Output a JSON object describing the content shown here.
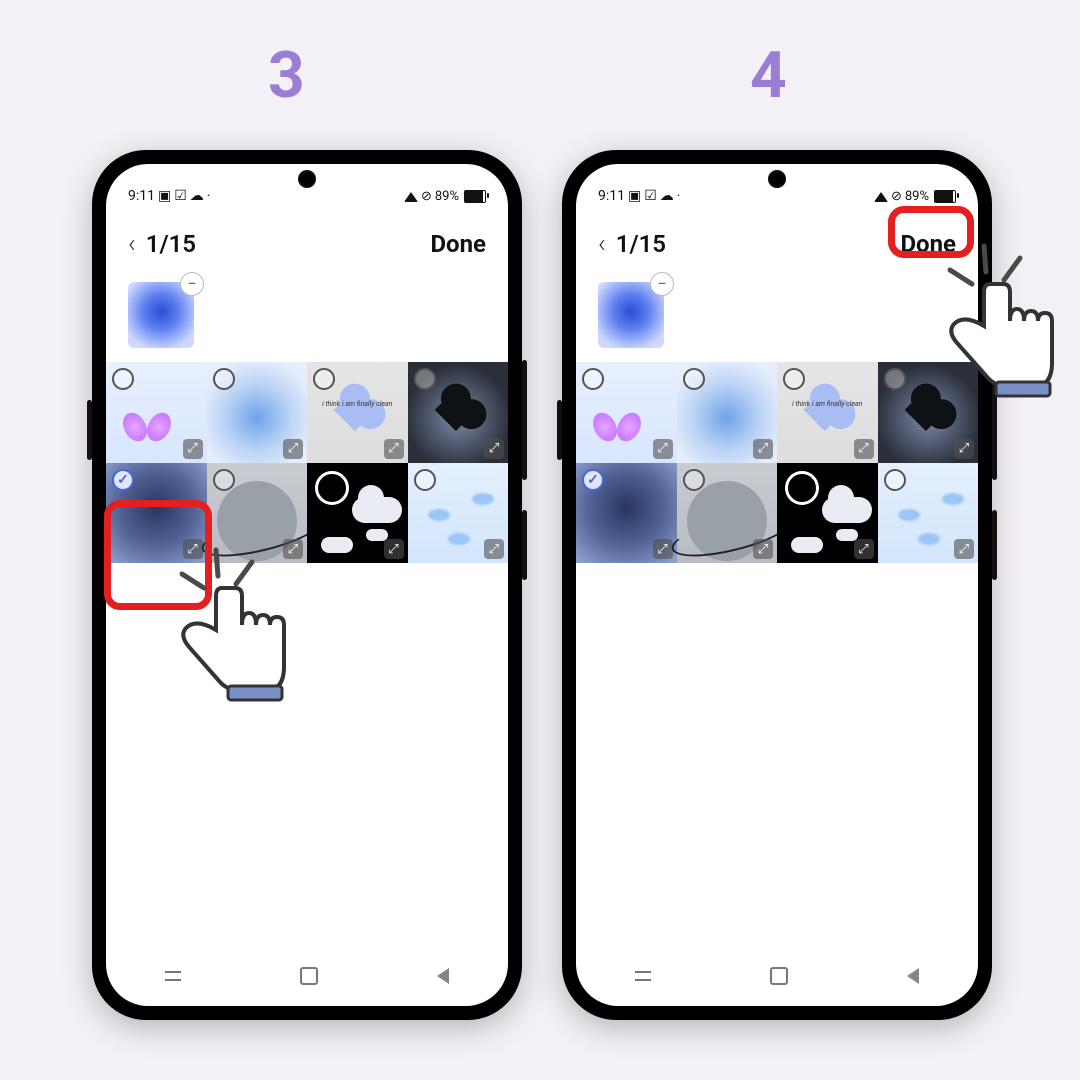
{
  "steps": {
    "left": "3",
    "right": "4"
  },
  "status": {
    "time": "9:11",
    "batt": "89%"
  },
  "hdr": {
    "counter": "1/15",
    "done": "Done"
  },
  "cells": {
    "c2_txt": "i think i am finally clean"
  },
  "colors": {
    "accent_step": "#9c7dd6",
    "highlight": "#e41f1f"
  }
}
